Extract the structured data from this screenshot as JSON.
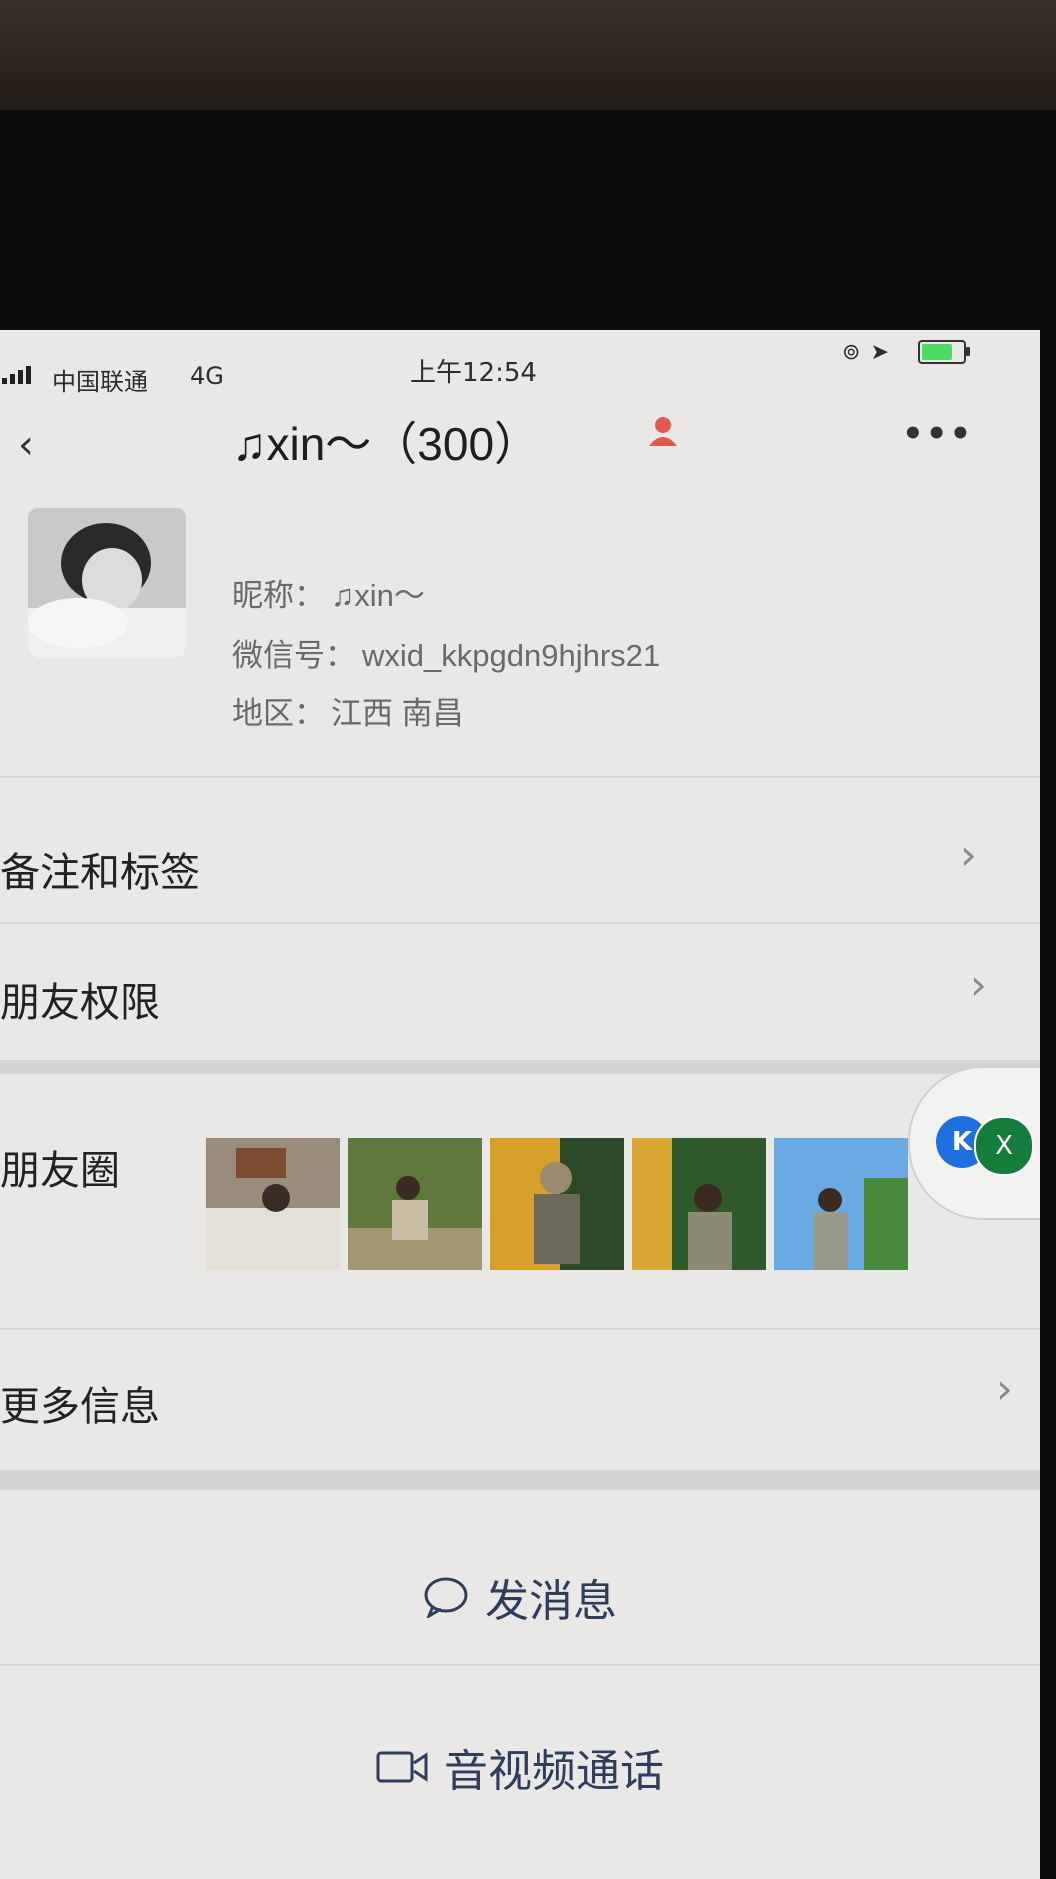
{
  "status_bar": {
    "carrier": "中国联通",
    "network": "4G",
    "time": "上午12:54"
  },
  "profile": {
    "display_name": "♫xin～（300）",
    "nickname_label": "昵称：",
    "nickname": "♫xin～",
    "wechat_id_label": "微信号：",
    "wechat_id": "wxid_kkpgdn9hjhrs21",
    "region_label": "地区：",
    "region": "江西 南昌"
  },
  "rows": {
    "remarks_tags": "备注和标签",
    "moments_permissions": "朋友权限",
    "moments": "朋友圈",
    "more_info": "更多信息"
  },
  "actions": {
    "send_message": "发消息",
    "video_call": "音视频通话"
  },
  "floating": {
    "k_label": "K",
    "x_label": "X"
  },
  "icons": [
    "back-icon",
    "more-icon",
    "gender-icon",
    "chevron-right-icon",
    "chat-bubble-icon",
    "video-camera-icon"
  ],
  "colors": {
    "screen_bg": "#e9e8e6",
    "action_text": "#2f3d5d",
    "gender_icon": "#e05a4e",
    "battery": "#4cd964"
  }
}
